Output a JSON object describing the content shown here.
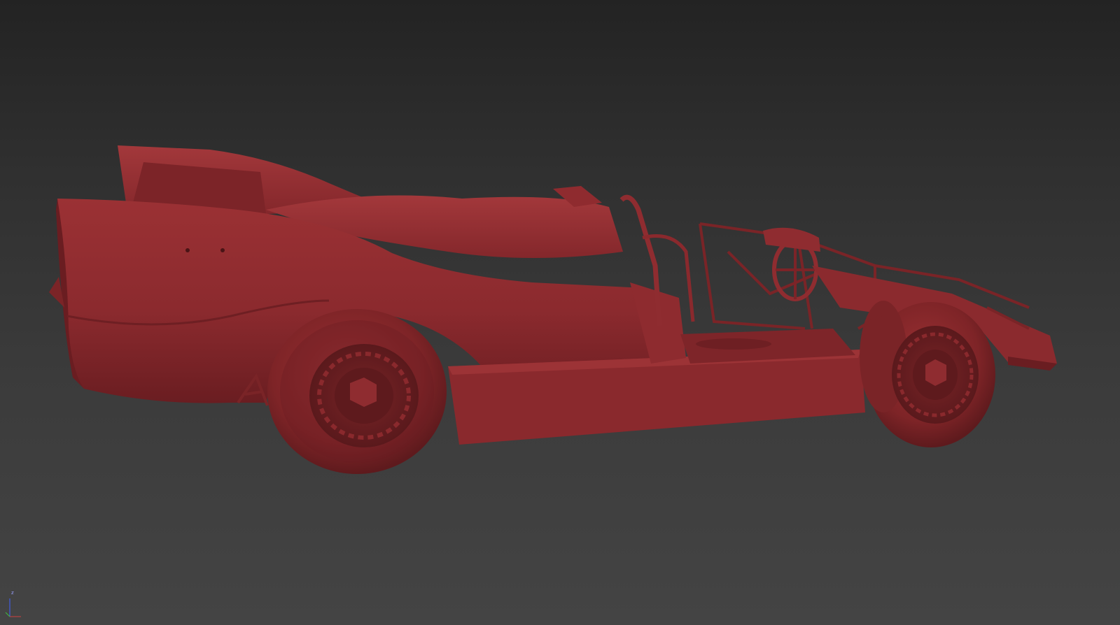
{
  "viewport": {
    "name": "perspective-viewport",
    "background_top": "#232323",
    "background_bottom": "#444444"
  },
  "model": {
    "name": "race-car-model",
    "shading": "clay",
    "base_color": "#8b2a2e",
    "shadow_color": "#5e1a1d",
    "highlight_color": "#a53a3d"
  },
  "axis_gizmo": {
    "z_label": "z",
    "x_color": "#d04040",
    "y_color": "#40c040",
    "z_color": "#4060ff"
  }
}
